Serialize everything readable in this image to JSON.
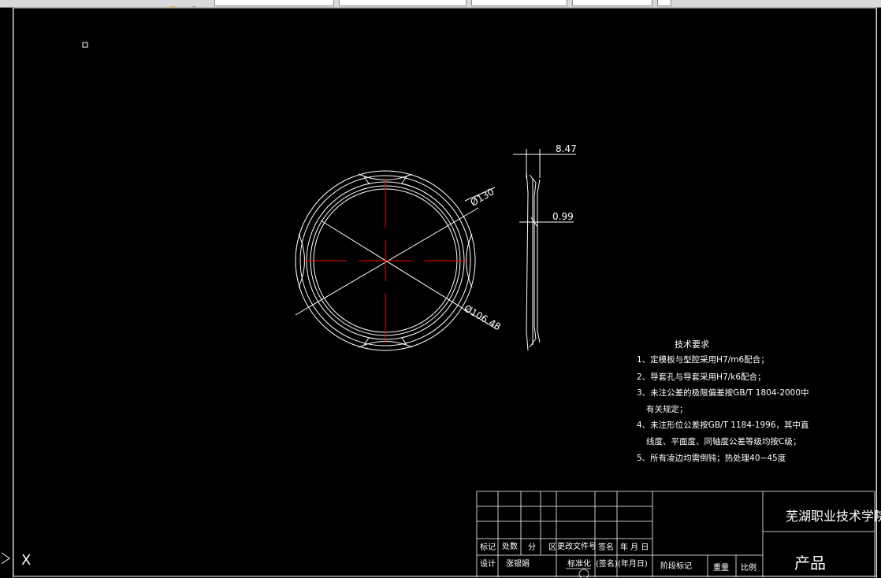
{
  "toolbar": {
    "fields": [
      "",
      "",
      "",
      "",
      ""
    ]
  },
  "drawing": {
    "dimensions": {
      "outer_diameter": "Ø130",
      "inner_diameter": "Ø106.48",
      "thickness": "8.47",
      "wall": "0.99"
    },
    "tech_requirements": {
      "title": "技术要求",
      "items": [
        "1、定模板与型腔采用H7/m6配合；",
        "2、导套孔与导套采用H7/k6配合；",
        "3、未注公差的极限偏差按GB/T 1804-2000中",
        "有关规定；",
        "4、未注形位公差按GB/T 1184-1996，其中直",
        "线度、平面度、同轴度公差等级均按C级；",
        "5、所有凌边均需倒钝；热处理40~45度"
      ]
    },
    "title_block": {
      "school": "芜湖职业技术学院",
      "product": "产品",
      "row_labels": [
        "标记",
        "处数",
        "分",
        "区",
        "更改文件号",
        "签名",
        "年 月 日"
      ],
      "row_labels_2": [
        "设计",
        "涨银娟",
        "标准化",
        "(签名)",
        "(年月日)"
      ],
      "stage_mark": "阶段标记",
      "weight": "重量",
      "scale": "比例"
    },
    "axis_icon": "X"
  }
}
